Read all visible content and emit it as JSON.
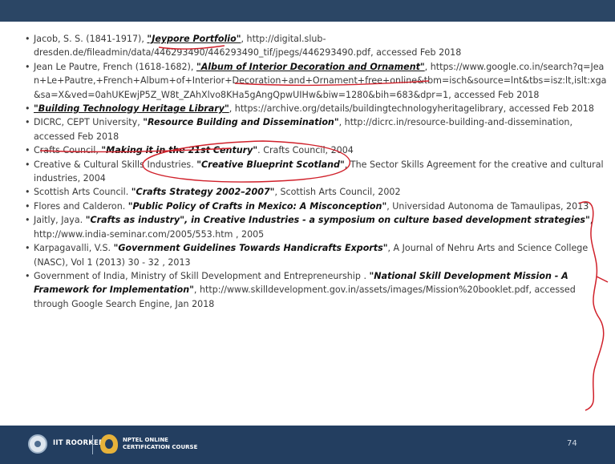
{
  "slide": {
    "references": [
      {
        "parts": [
          {
            "t": "Jacob, S. S. (1841-1917), "
          },
          {
            "t": "\"Jeypore Portfolio\"",
            "s": "bu"
          },
          {
            "t": ", http://digital.slub-dresden.de/fileadmin/data/446293490/446293490_tif/jpegs/446293490.pdf, accessed Feb 2018"
          }
        ]
      },
      {
        "parts": [
          {
            "t": "Jean Le Pautre, French (1618-1682), "
          },
          {
            "t": "\"Album of Interior Decoration and Ornament\"",
            "s": "bu"
          },
          {
            "t": ", "
          },
          {
            "t": "https://www.google.co.in/search?q=Jean+Le+Pautre,+French+Album+of+Interior+Decoration+and+Ornament+free+online&tbm=isch&source=lnt&tbs=isz:lt,islt:xga&sa=X&ved=0ahUKEwjP5Z_W8t_ZAhXlvo8KHa5gAngQpwUIHw&biw=1280&bih=683&dpr=1",
            "s": "url"
          },
          {
            "t": ", accessed Feb 2018"
          }
        ]
      },
      {
        "parts": [
          {
            "t": "\"Building Technology Heritage Library\"",
            "s": "bu"
          },
          {
            "t": ", https://archive.org/details/buildingtechnologyheritagelibrary, accessed Feb 2018"
          }
        ]
      },
      {
        "parts": [
          {
            "t": "DICRC, CEPT University, "
          },
          {
            "t": "\"Resource Building and Dissemination\"",
            "s": "b"
          },
          {
            "t": ", http://dicrc.in/resource-building-and-dissemination, accessed Feb 2018"
          }
        ]
      },
      {
        "parts": [
          {
            "t": "Crafts Council, "
          },
          {
            "t": "\"Making it in the 21st Century\"",
            "s": "b"
          },
          {
            "t": ". Crafts Council, 2004"
          }
        ]
      },
      {
        "parts": [
          {
            "t": "Creative & Cultural Skills Industries. "
          },
          {
            "t": "\"Creative Blueprint Scotland\"",
            "s": "b"
          },
          {
            "t": ", The Sector Skills Agreement for the creative and cultural industries, 2004"
          }
        ]
      },
      {
        "parts": [
          {
            "t": "Scottish Arts Council. "
          },
          {
            "t": "\"Crafts Strategy 2002–2007\"",
            "s": "b"
          },
          {
            "t": ", Scottish Arts Council, 2002"
          }
        ]
      },
      {
        "parts": [
          {
            "t": "Flores and Calderon. "
          },
          {
            "t": "\"Public Policy of Crafts in Mexico: A Misconception\"",
            "s": "b"
          },
          {
            "t": ", Universidad Autonoma de Tamaulipas, 2013"
          }
        ]
      },
      {
        "parts": [
          {
            "t": "Jaitly, Jaya. "
          },
          {
            "t": "\"Crafts as industry\", in Creative Industries - a symposium on culture based  development strategies\"",
            "s": "b"
          },
          {
            "t": ", http://www.india-seminar.com/2005/553.htm , 2005"
          }
        ]
      },
      {
        "parts": [
          {
            "t": "Karpagavalli, V.S. "
          },
          {
            "t": "\"Government Guidelines Towards Handicrafts Exports\"",
            "s": "b"
          },
          {
            "t": ", A Journal of Nehru Arts and Science College (NASC), Vol 1 (2013) 30 - 32 , 2013"
          }
        ]
      },
      {
        "parts": [
          {
            "t": "Government of India, Ministry of Skill Development and Entrepreneurship . "
          },
          {
            "t": "\"National Skill Development Mission - A Framework for Implementation\"",
            "s": "b"
          },
          {
            "t": ", http://www.skilldevelopment.gov.in/assets/images/Mission%20booklet.pdf, accessed through Google Search Engine, Jan 2018"
          }
        ]
      }
    ]
  },
  "footer": {
    "iit_label": "IIT ROORKEE",
    "nptel_line1": "NPTEL ONLINE",
    "nptel_line2": "CERTIFICATION COURSE",
    "page_number": "74"
  },
  "colors": {
    "header_bar": "#2b4665",
    "footer_bar": "#233e60",
    "annotation_ink": "#d0202a"
  }
}
